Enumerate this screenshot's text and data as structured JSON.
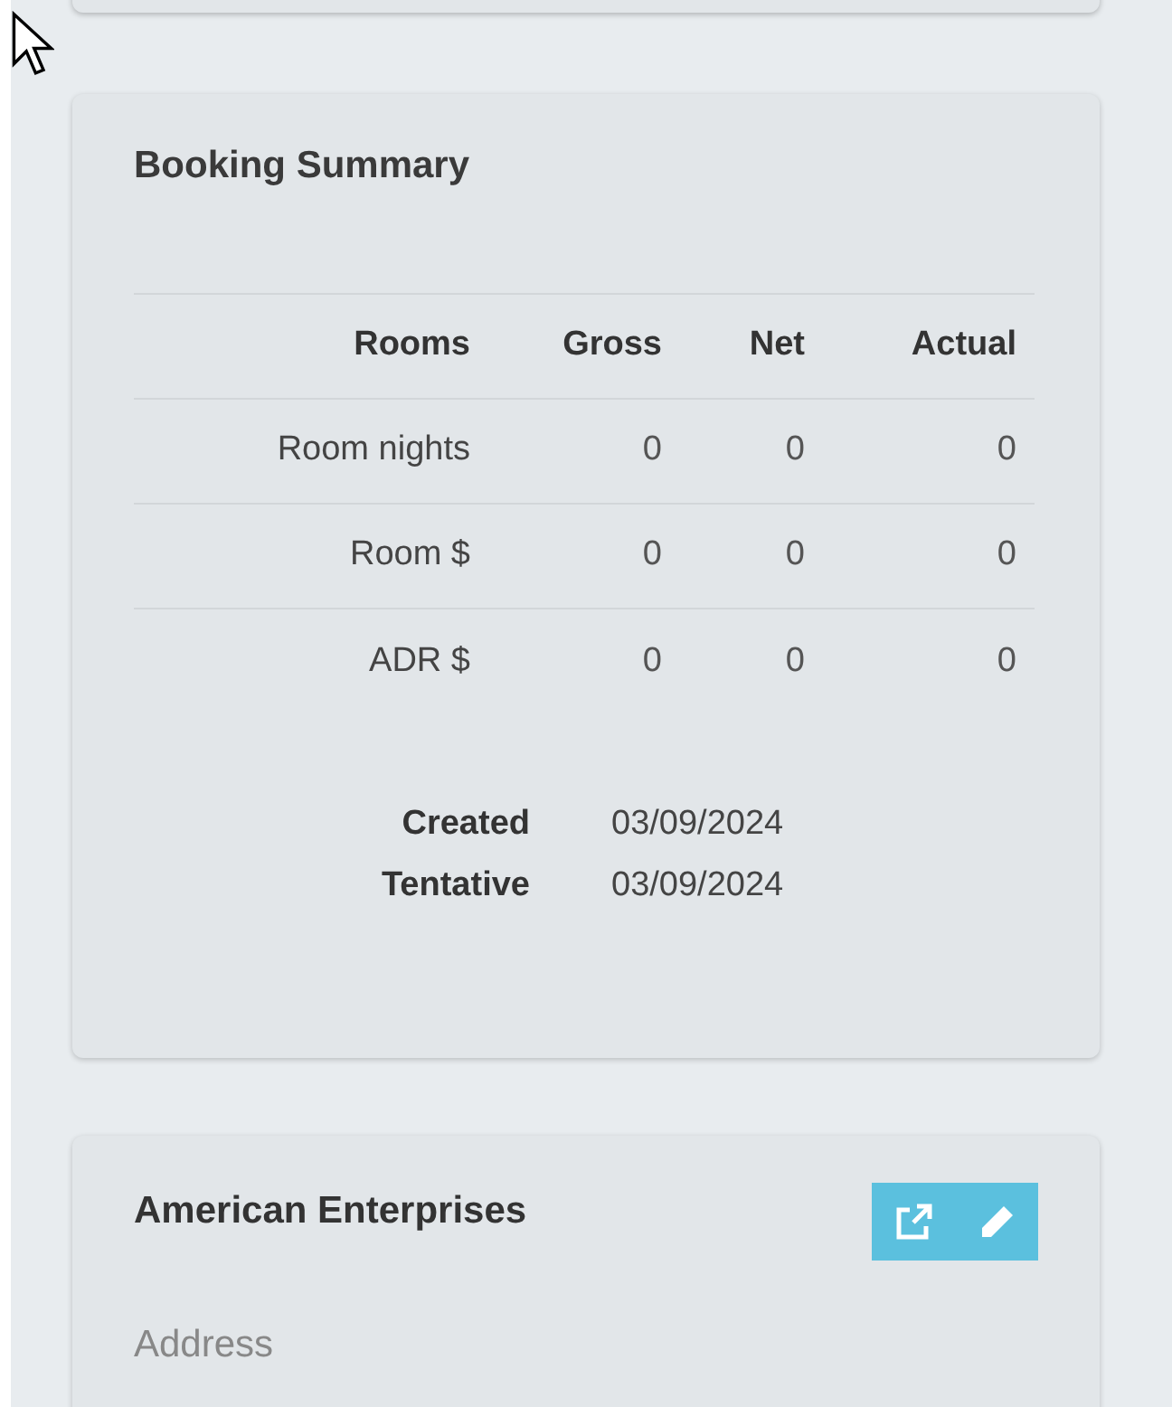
{
  "booking_summary": {
    "title": "Booking Summary",
    "table": {
      "columns": [
        "Rooms",
        "Gross",
        "Net",
        "Actual"
      ],
      "rows": [
        [
          "Room nights",
          "0",
          "0",
          "0"
        ],
        [
          "Room $",
          "0",
          "0",
          "0"
        ],
        [
          "ADR $",
          "0",
          "0",
          "0"
        ]
      ]
    },
    "dates": [
      {
        "label": "Created",
        "value": "03/09/2024"
      },
      {
        "label": "Tentative",
        "value": "03/09/2024"
      }
    ]
  },
  "account": {
    "title": "American Enterprises",
    "section": "Address"
  }
}
